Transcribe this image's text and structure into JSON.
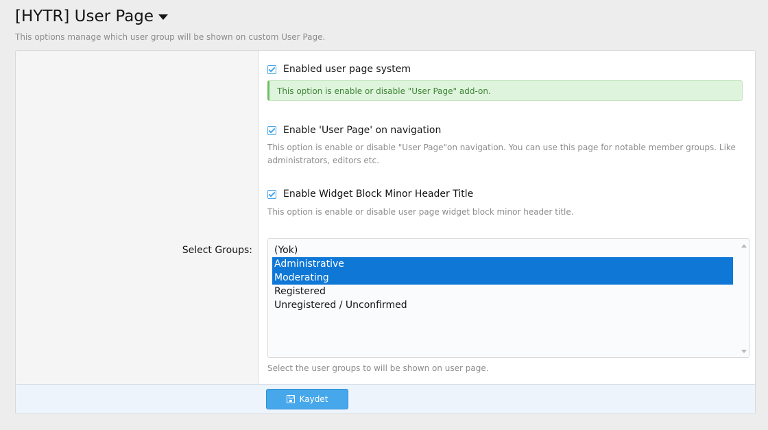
{
  "header": {
    "title": "[HYTR] User Page",
    "description": "This options manage which user group will be shown on custom User Page."
  },
  "options": [
    {
      "label": "Enabled user page system",
      "checked": true,
      "hint": "This option is enable or disable \"User Page\" add-on."
    },
    {
      "label": "Enable 'User Page' on navigation",
      "checked": true,
      "hint": "This option is enable or disable \"User Page\"on navigation. You can use this page for notable member groups. Like administrators, editors etc."
    },
    {
      "label": "Enable Widget Block Minor Header Title",
      "checked": true,
      "hint": "This option is enable or disable user page widget block minor header title."
    }
  ],
  "groups": {
    "label": "Select Groups:",
    "items": [
      {
        "label": "(Yok)",
        "selected": false
      },
      {
        "label": "Administrative",
        "selected": true
      },
      {
        "label": "Moderating",
        "selected": true
      },
      {
        "label": "Registered",
        "selected": false
      },
      {
        "label": "Unregistered / Unconfirmed",
        "selected": false
      }
    ],
    "hint": "Select the user groups to will be shown on user page."
  },
  "footer": {
    "save_label": "Kaydet"
  },
  "colors": {
    "accent": "#47a7eb",
    "selection": "#0f78d7",
    "success_bg": "#dff4dc"
  }
}
